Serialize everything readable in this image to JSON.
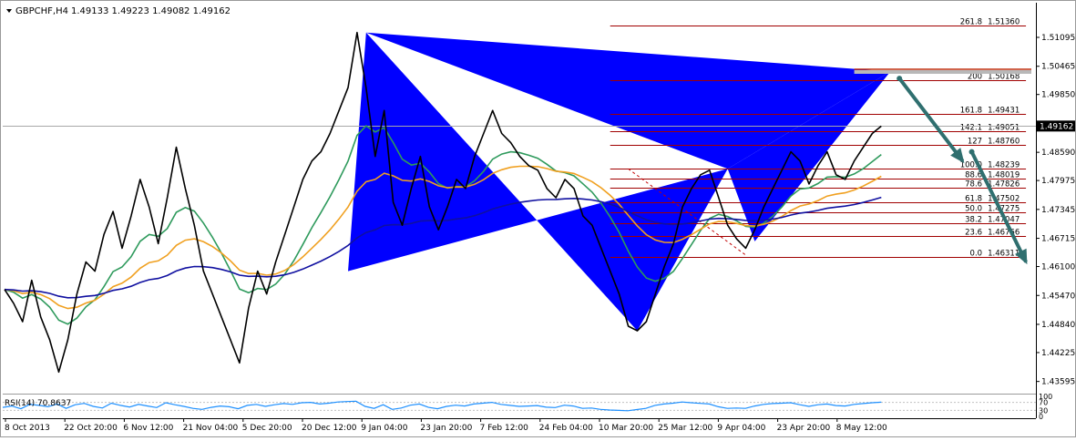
{
  "header": {
    "symbol": "GBPCHF,H4",
    "ohlc": "1.49133 1.49223 1.49082 1.49162"
  },
  "chart_data": {
    "type": "line",
    "title": "GBPCHF,H4",
    "ylim": [
      1.4335,
      1.5185
    ],
    "price_ticks": [
      "1.51095",
      "1.50465",
      "1.49850",
      "1.49162",
      "1.48590",
      "1.47975",
      "1.47345",
      "1.46715",
      "1.46100",
      "1.45470",
      "1.44840",
      "1.44225",
      "1.43595"
    ],
    "time_labels": [
      "8 Oct 2013",
      "22 Oct 20:00",
      "6 Nov 12:00",
      "21 Nov 04:00",
      "5 Dec 20:00",
      "20 Dec 12:00",
      "9 Jan 04:00",
      "23 Jan 20:00",
      "7 Feb 12:00",
      "24 Feb 04:00",
      "10 Mar 20:00",
      "25 Mar 12:00",
      "9 Apr 04:00",
      "23 Apr 20:00",
      "8 May 12:00"
    ],
    "current_price": "1.49162",
    "close": [
      1.456,
      1.453,
      1.449,
      1.458,
      1.45,
      1.445,
      1.438,
      1.445,
      1.455,
      1.462,
      1.46,
      1.468,
      1.473,
      1.465,
      1.472,
      1.48,
      1.474,
      1.466,
      1.476,
      1.487,
      1.478,
      1.47,
      1.46,
      1.455,
      1.45,
      1.445,
      1.44,
      1.452,
      1.46,
      1.455,
      1.462,
      1.468,
      1.474,
      1.48,
      1.484,
      1.486,
      1.49,
      1.495,
      1.5,
      1.512,
      1.5,
      1.485,
      1.495,
      1.475,
      1.47,
      1.478,
      1.485,
      1.474,
      1.469,
      1.474,
      1.48,
      1.478,
      1.485,
      1.49,
      1.495,
      1.49,
      1.488,
      1.485,
      1.483,
      1.482,
      1.478,
      1.476,
      1.48,
      1.478,
      1.472,
      1.47,
      1.465,
      1.46,
      1.455,
      1.448,
      1.447,
      1.449,
      1.455,
      1.461,
      1.466,
      1.474,
      1.478,
      1.481,
      1.482,
      1.476,
      1.47,
      1.467,
      1.465,
      1.469,
      1.474,
      1.478,
      1.482,
      1.486,
      1.484,
      1.479,
      1.483,
      1.486,
      1.481,
      1.48,
      1.484,
      1.487,
      1.49,
      1.4916
    ],
    "series": [
      {
        "color": "#2e9a5c",
        "period": 9
      },
      {
        "color": "#f0a020",
        "period": 21
      },
      {
        "color": "#1010a0",
        "period": 55
      }
    ],
    "pattern": {
      "color": "#0000ff",
      "points": [
        [
          38,
          1.46
        ],
        [
          40,
          1.512
        ],
        [
          70,
          1.447
        ],
        [
          80,
          1.4823
        ],
        [
          83,
          1.4665
        ],
        [
          98,
          1.5035
        ]
      ]
    },
    "fib_levels": [
      {
        "ratio": "261.8",
        "price": "1.51360"
      },
      {
        "ratio": "200",
        "price": "1.50168"
      },
      {
        "ratio": "161.8",
        "price": "1.49431"
      },
      {
        "ratio": "142.1",
        "price": "1.49051"
      },
      {
        "ratio": "127",
        "price": "1.48760"
      },
      {
        "ratio": "100.0",
        "price": "1.48239"
      },
      {
        "ratio": "88.6",
        "price": "1.48019"
      },
      {
        "ratio": "78.6",
        "price": "1.47826"
      },
      {
        "ratio": "61.8",
        "price": "1.47502"
      },
      {
        "ratio": "50.0",
        "price": "1.47275"
      },
      {
        "ratio": "38.2",
        "price": "1.47047"
      },
      {
        "ratio": "23.6",
        "price": "1.46766"
      },
      {
        "ratio": "0.0",
        "price": "1.46311"
      }
    ],
    "target_line": 1.504,
    "arrows": [
      [
        [
          99,
          1.502
        ],
        [
          106,
          1.484
        ]
      ],
      [
        [
          107,
          1.486
        ],
        [
          113,
          1.462
        ]
      ]
    ],
    "rsi": {
      "label": "RSI(14) 70.8637",
      "ticks": [
        "100",
        "70",
        "30",
        "0"
      ],
      "values": [
        45,
        52,
        38,
        60,
        55,
        48,
        62,
        40,
        58,
        65,
        50,
        42,
        66,
        55,
        47,
        60,
        52,
        44,
        68,
        58,
        50,
        40,
        35,
        45,
        52,
        48,
        38,
        55,
        60,
        50,
        58,
        64,
        60,
        68,
        70,
        62,
        66,
        72,
        74,
        76,
        50,
        40,
        58,
        35,
        42,
        56,
        62,
        45,
        38,
        50,
        56,
        52,
        62,
        66,
        70,
        60,
        55,
        50,
        52,
        54,
        46,
        44,
        56,
        52,
        40,
        42,
        35,
        32,
        30,
        28,
        34,
        40,
        55,
        62,
        66,
        72,
        68,
        65,
        62,
        48,
        40,
        42,
        40,
        52,
        60,
        64,
        66,
        68,
        58,
        50,
        58,
        62,
        54,
        52,
        60,
        64,
        68,
        71
      ]
    }
  }
}
